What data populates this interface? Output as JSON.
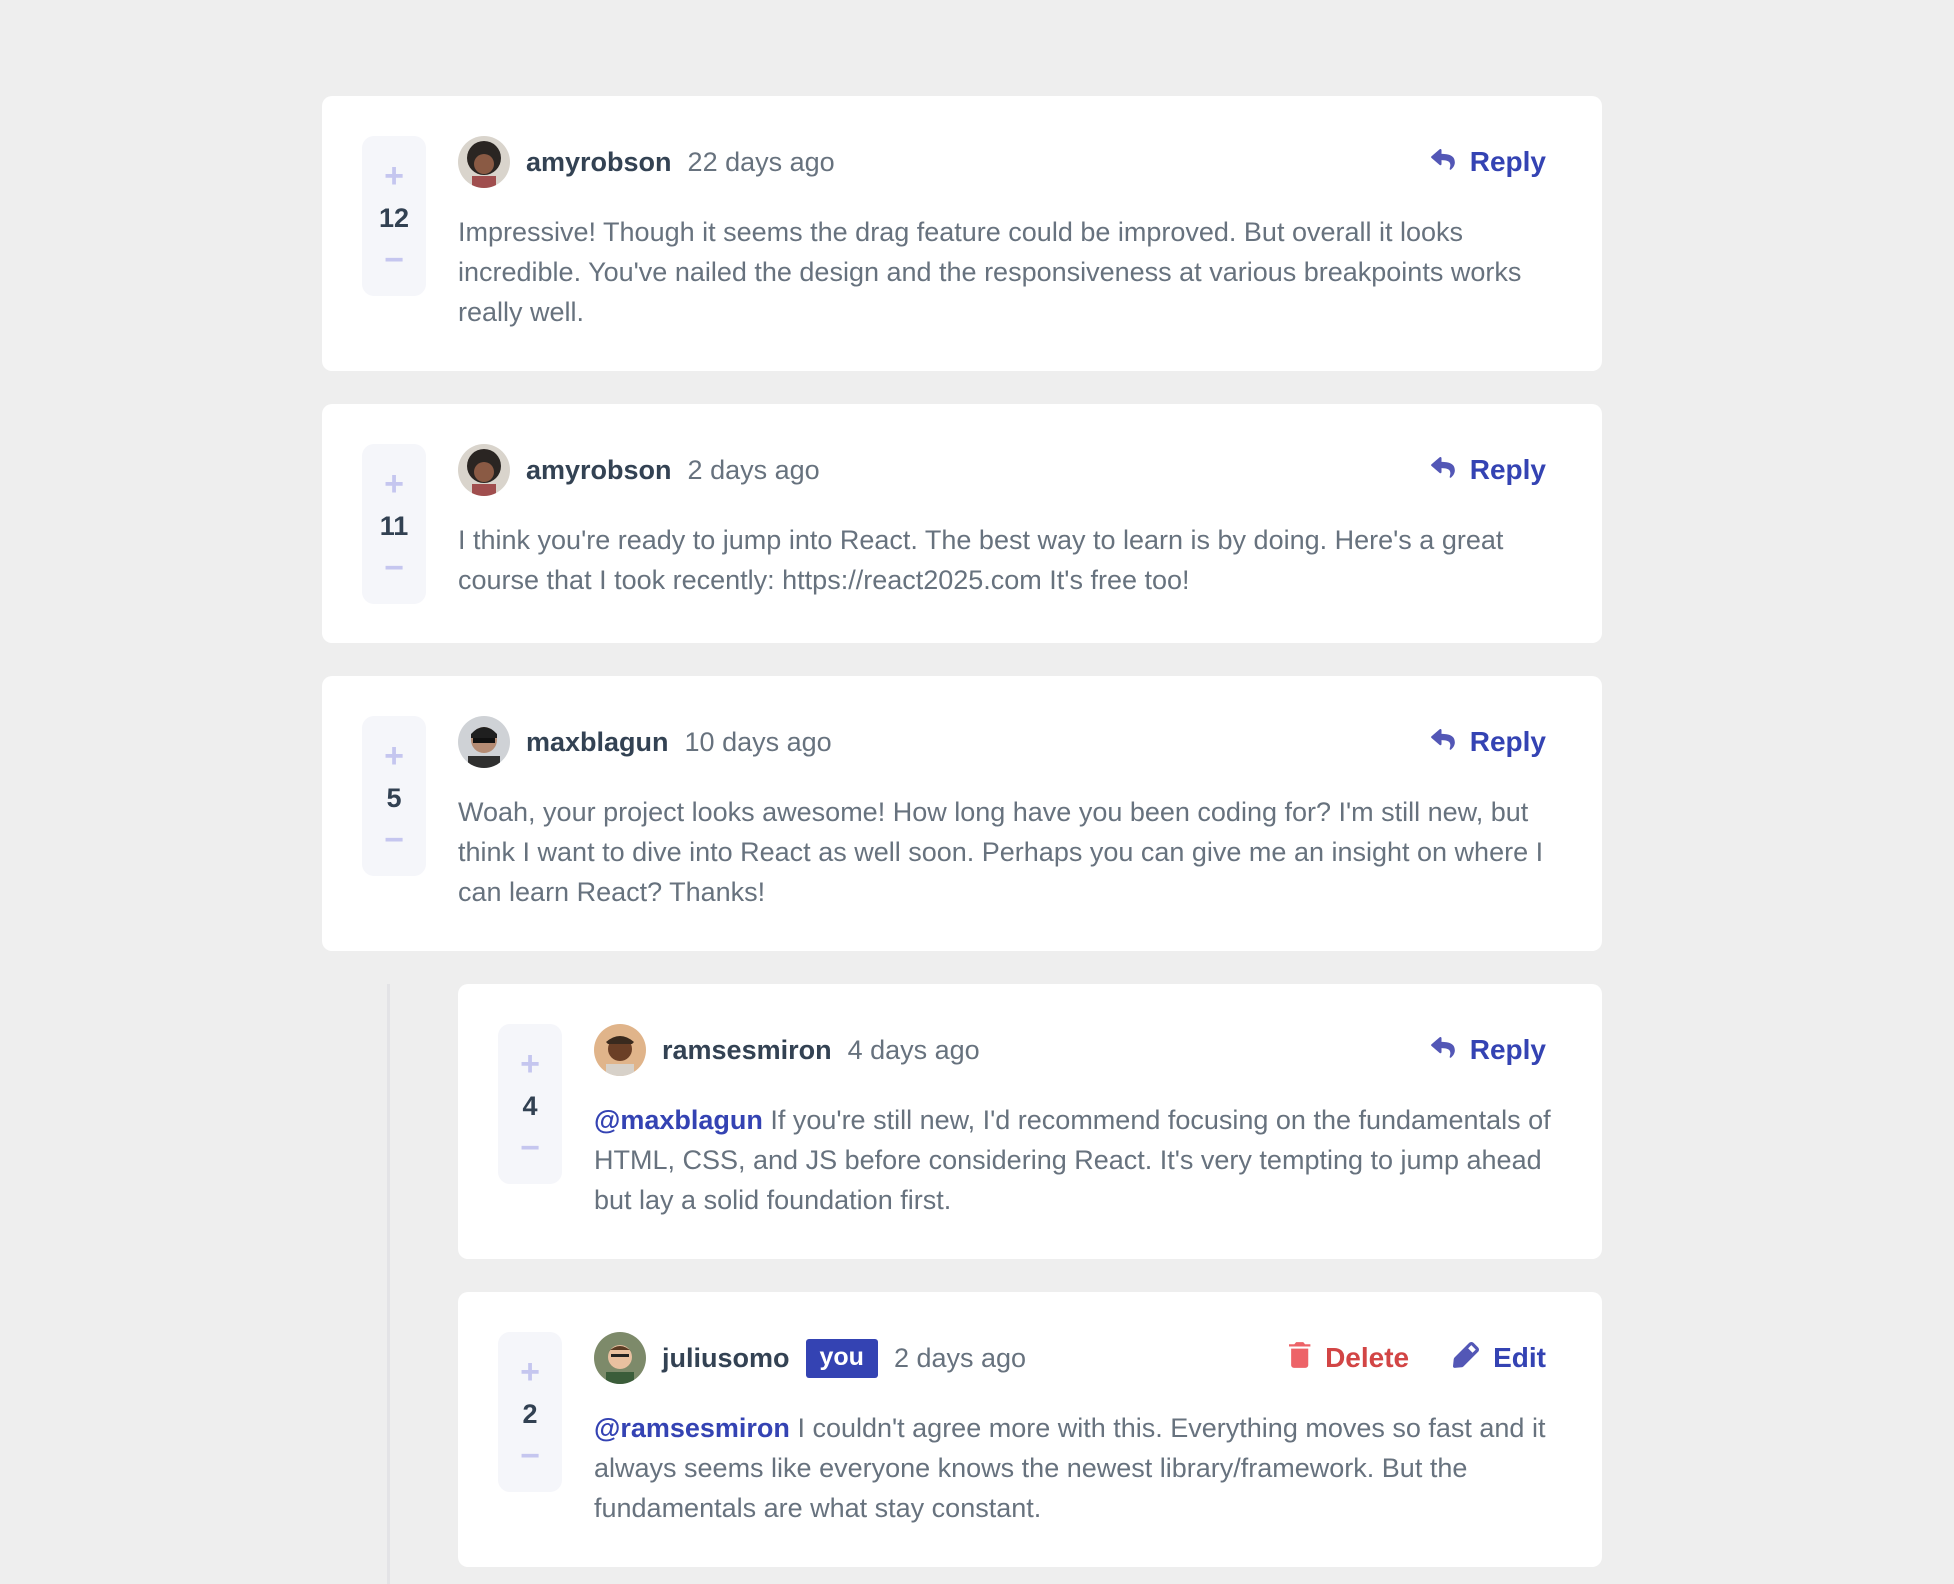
{
  "comments": [
    {
      "score": "12",
      "username": "amyrobson",
      "date": "22 days ago",
      "reply_label": "Reply",
      "text": "Impressive! Though it seems the drag feature could be improved. But overall it looks incredible. You've nailed the design and the responsiveness at various breakpoints works really well."
    },
    {
      "score": "11",
      "username": "amyrobson",
      "date": "2 days ago",
      "reply_label": "Reply",
      "text": "I think you're ready to jump into React. The best way to learn is by doing. Here's a great course that I took recently: https://react2025.com It's free too!"
    },
    {
      "score": "5",
      "username": "maxblagun",
      "date": "10 days ago",
      "reply_label": "Reply",
      "text": "Woah, your project looks awesome! How long have you been coding for? I'm still new, but think I want to dive into React as well soon. Perhaps you can give me an insight on where I can learn React? Thanks!"
    }
  ],
  "replies": [
    {
      "score": "4",
      "username": "ramsesmiron",
      "date": "4 days ago",
      "reply_label": "Reply",
      "mention": "@maxblagun",
      "text": "If you're still new, I'd recommend focusing on the fundamentals of HTML, CSS, and JS before considering React. It's very tempting to jump ahead but lay a solid foundation first."
    },
    {
      "score": "2",
      "username": "juliusomo",
      "you_tag": "you",
      "date": "2 days ago",
      "delete_label": "Delete",
      "edit_label": "Edit",
      "mention": "@ramsesmiron",
      "text": "I couldn't agree more with this. Everything moves so fast and it always seems like everyone knows the newest library/framework. But the fundamentals are what stay constant."
    }
  ],
  "vote_icons": {
    "plus": "+",
    "minus": "−"
  },
  "icons": [
    "plus-icon",
    "minus-icon",
    "reply-icon",
    "delete-icon",
    "edit-icon"
  ],
  "colors": {
    "background": "#eeeeee",
    "card": "#ffffff",
    "accent": "#3443b3",
    "danger": "#d24545",
    "vote_bg": "#f5f6fa",
    "vote_icon": "#c5c6ef"
  }
}
